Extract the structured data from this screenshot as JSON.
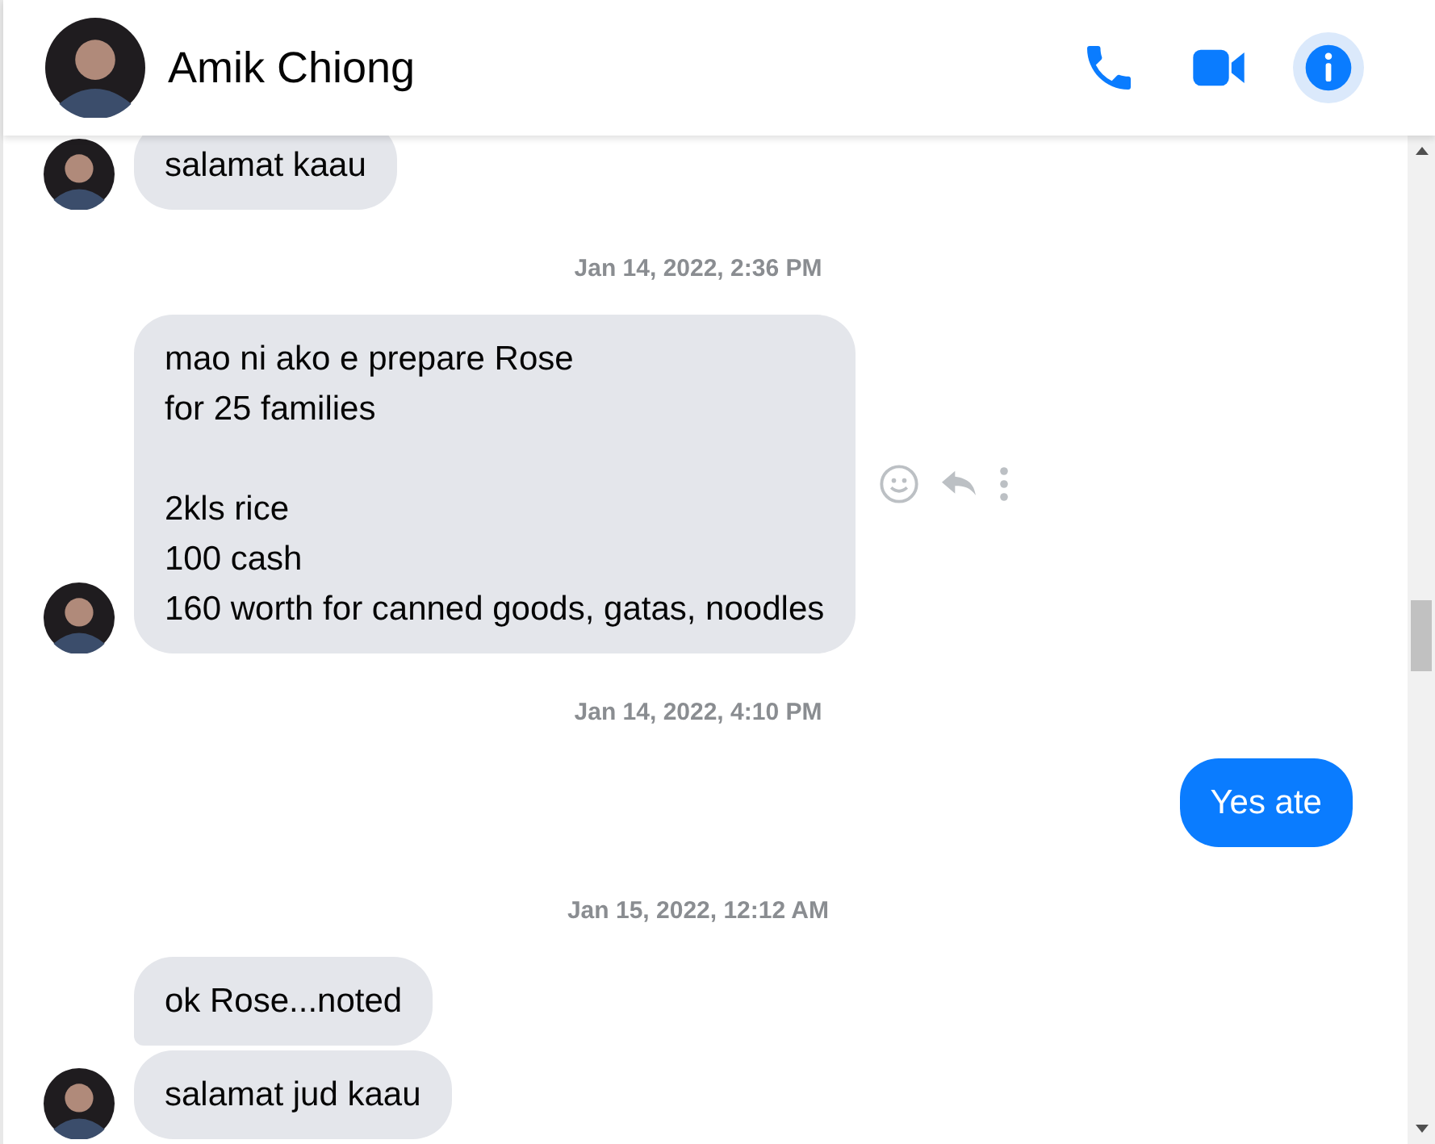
{
  "header": {
    "contact_name": "Amik Chiong",
    "actions": [
      {
        "kind": "call",
        "selected": false
      },
      {
        "kind": "video",
        "selected": false
      },
      {
        "kind": "info",
        "selected": true
      }
    ]
  },
  "messages": [
    {
      "kind": "received",
      "text": "salamat kaau",
      "avatar": true,
      "hover_actions": false
    },
    {
      "kind": "time",
      "text": "Jan 14, 2022, 2:36 PM"
    },
    {
      "kind": "received",
      "text": "mao ni ako e prepare Rose\nfor 25 families\n\n2kls rice\n100 cash\n160 worth for canned goods, gatas, noodles",
      "avatar": true,
      "hover_actions": true
    },
    {
      "kind": "time",
      "text": "Jan 14, 2022, 4:10 PM"
    },
    {
      "kind": "sent",
      "text": "Yes ate"
    },
    {
      "kind": "time",
      "text": "Jan 15, 2022, 12:12 AM"
    },
    {
      "kind": "received",
      "text": "ok Rose...noted",
      "avatar": false,
      "hover_actions": false
    },
    {
      "kind": "received",
      "text": "salamat jud kaau",
      "avatar": true,
      "hover_actions": false
    }
  ]
}
